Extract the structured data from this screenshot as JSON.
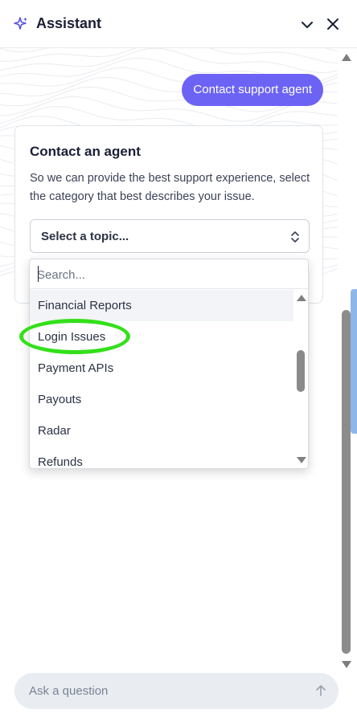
{
  "header": {
    "title": "Assistant",
    "icons": [
      "sparkle-icon",
      "chevron-down-icon",
      "close-icon"
    ]
  },
  "conversation": {
    "user_message": "Contact support agent"
  },
  "contact_card": {
    "title": "Contact an agent",
    "description": "So we can provide the best support experience, select the category that best describes your issue.",
    "select_value": "Select a topic..."
  },
  "dropdown": {
    "search_placeholder": "Search...",
    "options": [
      "Financial Reports",
      "Login Issues",
      "Payment APIs",
      "Payouts",
      "Radar",
      "Refunds"
    ],
    "hovered_option": "Financial Reports",
    "circled_option": "Login Issues"
  },
  "footer": {
    "ask_placeholder": "Ask a question"
  },
  "colors": {
    "accent": "#6c63f5",
    "highlight_ring": "#33e01a"
  }
}
